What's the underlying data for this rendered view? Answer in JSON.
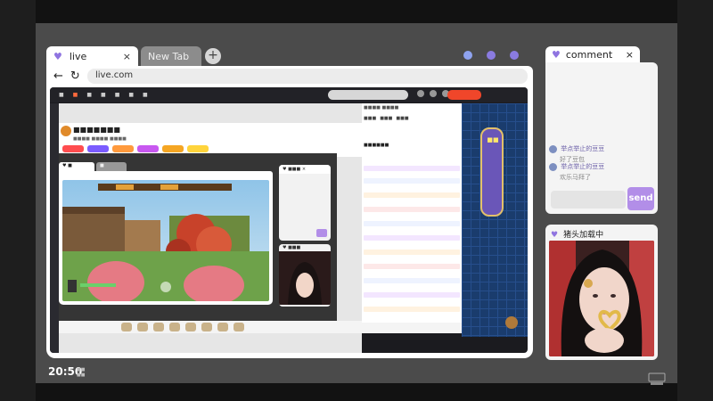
{
  "browser": {
    "tabs": [
      {
        "label": "live",
        "close": "×"
      },
      {
        "label": "New Tab"
      }
    ],
    "new_tab_icon": "plus-icon",
    "url": "live.com",
    "nav": {
      "back": "←",
      "reload": "↻"
    }
  },
  "comment_panel": {
    "title": "comment",
    "close": "×",
    "messages": [
      {
        "user": "举点举止的豆豆",
        "text": "好了豆包"
      },
      {
        "user": "举点举止的豆豆",
        "text": "欢乐马拜了"
      }
    ],
    "send_label": "send"
  },
  "cam_panel": {
    "title": "猪头加载中"
  },
  "clock": {
    "time": "20:50"
  },
  "colors": {
    "accent": "#b28ee8",
    "heart": "#8f74e0",
    "brand": "#f0462a"
  }
}
